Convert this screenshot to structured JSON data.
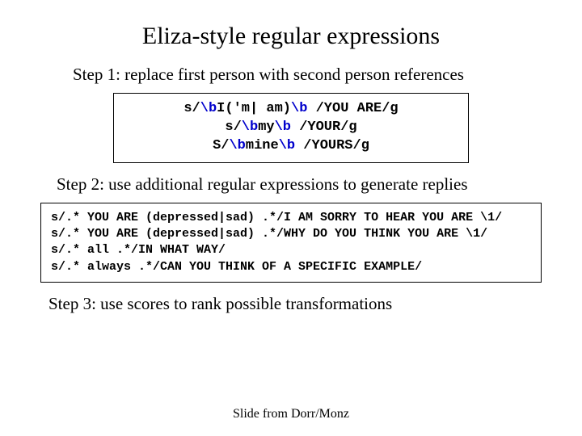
{
  "title": "Eliza-style regular expressions",
  "step1": "Step 1: replace first person with second person references",
  "box1": {
    "l1": {
      "a": "s/",
      "b": "\\b",
      "c": "I('m| am)",
      "d": "\\b",
      "e": " /YOU ARE/g"
    },
    "l2": {
      "a": "s/",
      "b": "\\b",
      "c": "my",
      "d": "\\b",
      "e": " /YOUR/g"
    },
    "l3": {
      "a": "S/",
      "b": "\\b",
      "c": "mine",
      "d": "\\b",
      "e": " /YOURS/g"
    }
  },
  "step2": "Step 2: use additional regular expressions to generate replies",
  "box2": {
    "l1": "s/.* YOU ARE (depressed|sad) .*/I AM SORRY TO HEAR YOU ARE \\1/",
    "l2": "s/.* YOU ARE (depressed|sad) .*/WHY DO YOU THINK YOU ARE \\1/",
    "l3": "s/.* all .*/IN WHAT WAY/",
    "l4": "s/.* always .*/CAN YOU THINK OF A SPECIFIC EXAMPLE/"
  },
  "step3": "Step 3: use scores to rank possible transformations",
  "footer": "Slide from Dorr/Monz"
}
